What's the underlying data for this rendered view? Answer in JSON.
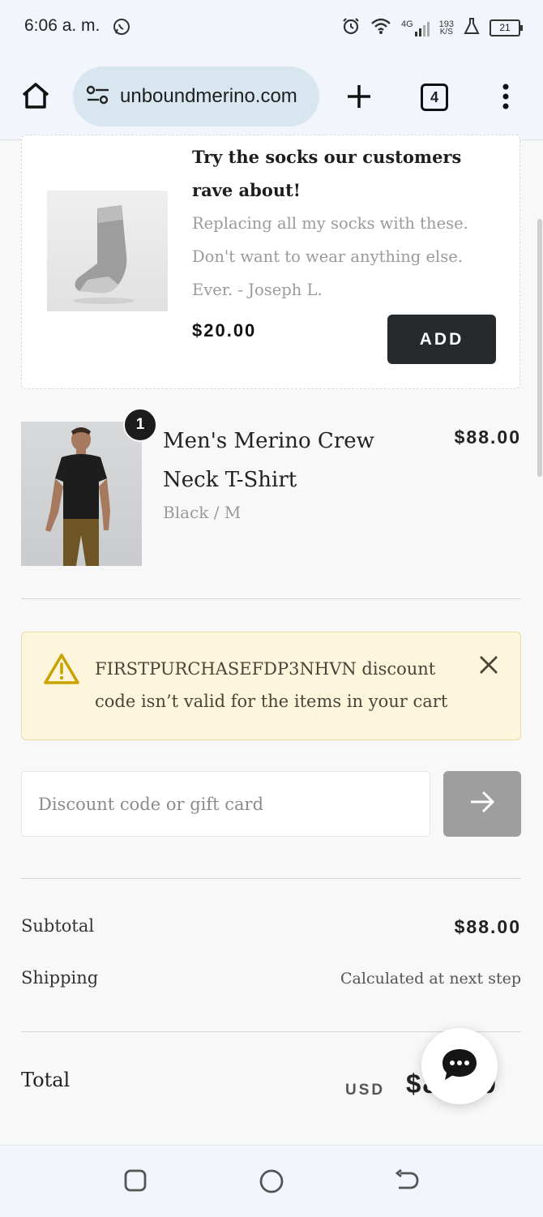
{
  "status_bar": {
    "time": "6:06 a. m.",
    "network": "4G",
    "speed_value": "193",
    "speed_unit": "K/S",
    "battery": "21"
  },
  "browser": {
    "url": "unboundmerino.com",
    "tab_count": "4"
  },
  "upsell": {
    "title": "Try the socks our customers rave about!",
    "quote": "Replacing all my socks with these. Don't want to wear anything else. Ever. - Joseph L.",
    "price": "$20.00",
    "add_label": "ADD"
  },
  "cart_item": {
    "quantity": "1",
    "name": "Men's Merino Crew Neck T-Shirt",
    "variant": "Black / M",
    "price": "$88.00"
  },
  "alert": {
    "message": "FIRSTPURCHASEFDP3NHVN discount code isn’t valid for the items in your cart"
  },
  "discount": {
    "placeholder": "Discount code or gift card"
  },
  "summary": {
    "subtotal_label": "Subtotal",
    "subtotal_value": "$88.00",
    "shipping_label": "Shipping",
    "shipping_value": "Calculated at next step",
    "total_label": "Total",
    "total_currency": "USD",
    "total_value": "$88.00"
  },
  "colors": {
    "primary_button": "#272a2c",
    "alert_bg": "#fdf6dd",
    "alert_icon": "#c9a100",
    "url_bar": "#d8e6ef"
  }
}
